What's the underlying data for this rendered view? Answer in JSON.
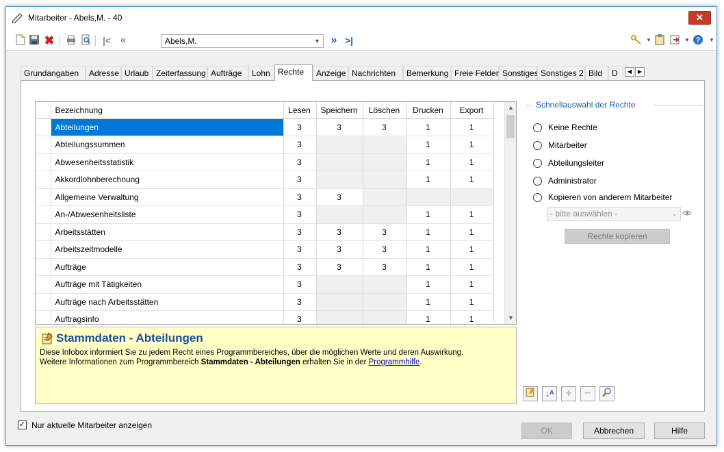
{
  "window": {
    "title": "Mitarbeiter - Abels,M. - 40",
    "close_label": "✕"
  },
  "toolbar": {
    "employee_value": "Abels,M."
  },
  "tabs": [
    {
      "label": "Grundangaben",
      "active": false
    },
    {
      "label": "Adresse",
      "active": false
    },
    {
      "label": "Urlaub",
      "active": false
    },
    {
      "label": "Zeiterfassung",
      "active": false
    },
    {
      "label": "Aufträge",
      "active": false
    },
    {
      "label": "Lohn",
      "active": false
    },
    {
      "label": "Rechte",
      "active": true
    },
    {
      "label": "Anzeige",
      "active": false
    },
    {
      "label": "Nachrichten",
      "active": false
    },
    {
      "label": "Bemerkung",
      "active": false
    },
    {
      "label": "Freie Felder",
      "active": false
    },
    {
      "label": "Sonstiges",
      "active": false
    },
    {
      "label": "Sonstiges 2",
      "active": false
    },
    {
      "label": "Bild",
      "active": false
    },
    {
      "label": "D",
      "active": false
    }
  ],
  "grid": {
    "columns": [
      "Bezeichnung",
      "Lesen",
      "Speichern",
      "Löschen",
      "Drucken",
      "Export"
    ],
    "rows": [
      {
        "name": "Abteilungen",
        "lesen": "3",
        "speichern": "3",
        "loeschen": "3",
        "drucken": "1",
        "export": "1",
        "selected": true
      },
      {
        "name": "Abteilungssummen",
        "lesen": "3",
        "speichern": "",
        "loeschen": "",
        "drucken": "1",
        "export": "1"
      },
      {
        "name": "Abwesenheitsstatistik",
        "lesen": "3",
        "speichern": "",
        "loeschen": "",
        "drucken": "1",
        "export": "1"
      },
      {
        "name": "Akkordlohnberechnung",
        "lesen": "3",
        "speichern": "",
        "loeschen": "",
        "drucken": "1",
        "export": "1"
      },
      {
        "name": "Allgemeine Verwaltung",
        "lesen": "3",
        "speichern": "3",
        "loeschen": "",
        "drucken": "",
        "export": ""
      },
      {
        "name": "An-/Abwesenheitsliste",
        "lesen": "3",
        "speichern": "",
        "loeschen": "",
        "drucken": "1",
        "export": "1"
      },
      {
        "name": "Arbeitsstätten",
        "lesen": "3",
        "speichern": "3",
        "loeschen": "3",
        "drucken": "1",
        "export": "1"
      },
      {
        "name": "Arbeitszeitmodelle",
        "lesen": "3",
        "speichern": "3",
        "loeschen": "3",
        "drucken": "1",
        "export": "1"
      },
      {
        "name": "Aufträge",
        "lesen": "3",
        "speichern": "3",
        "loeschen": "3",
        "drucken": "1",
        "export": "1"
      },
      {
        "name": "Aufträge mit Tätigkeiten",
        "lesen": "3",
        "speichern": "",
        "loeschen": "",
        "drucken": "1",
        "export": "1"
      },
      {
        "name": "Aufträge nach Arbeitsstätten",
        "lesen": "3",
        "speichern": "",
        "loeschen": "",
        "drucken": "1",
        "export": "1"
      },
      {
        "name": "Auftragsinfo",
        "lesen": "3",
        "speichern": "",
        "loeschen": "",
        "drucken": "1",
        "export": "1"
      }
    ]
  },
  "infobox": {
    "title": "Stammdaten - Abteilungen",
    "line1": "Diese Infobox informiert Sie zu jedem Recht eines Programmbereiches, über die möglichen Werte und deren Auswirkung.",
    "line2_prefix": "Weitere Informationen zum Programmbereich ",
    "line2_bold": "Stammdaten - Abteilungen",
    "line2_mid": " erhalten Sie in der ",
    "line2_link": "Programmhilfe",
    "line2_suffix": "."
  },
  "quick": {
    "legend": "Schnellauswahl der Rechte",
    "options": [
      "Keine Rechte",
      "Mitarbeiter",
      "Abteilungsleiter",
      "Administrator",
      "Kopieren von anderem Mitarbeiter"
    ],
    "copy_placeholder": "- bitte auswählen -",
    "copy_button": "Rechte kopieren"
  },
  "footer": {
    "checkbox_label": "Nur aktuelle Mitarbeiter anzeigen",
    "checkbox_checked": true,
    "ok": "OK",
    "cancel": "Abbrechen",
    "help": "Hilfe"
  }
}
